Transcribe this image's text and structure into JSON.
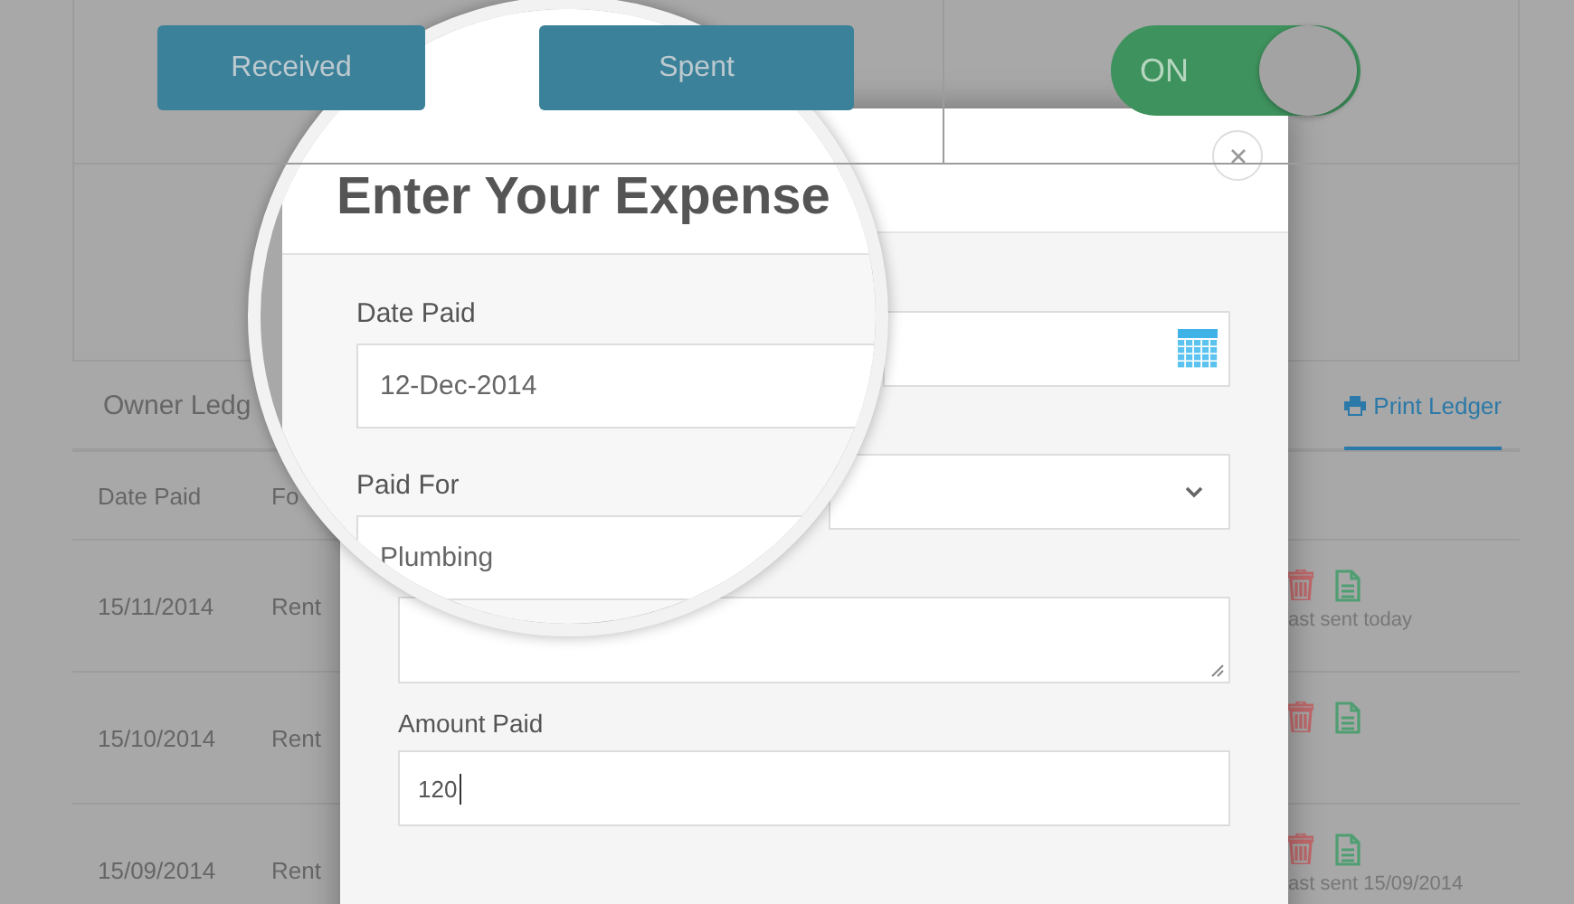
{
  "top_buttons": [
    {
      "label": "Received"
    },
    {
      "label": "Spent"
    }
  ],
  "toggle": {
    "label": "ON",
    "on": true
  },
  "ledger": {
    "tab_label": "Owner Ledg",
    "print_link": "Print Ledger",
    "columns": [
      "Date Paid",
      "Fo"
    ],
    "rows": [
      {
        "date": "15/11/2014",
        "paid_for": "Rent",
        "status": "ast sent today"
      },
      {
        "date": "15/10/2014",
        "paid_for": "Rent"
      },
      {
        "date": "15/09/2014",
        "paid_for": "Rent",
        "status": "ast sent 15/09/2014"
      }
    ]
  },
  "modal": {
    "title": "Enter Your Expense",
    "magnified": true,
    "fields": [
      {
        "kind": "date",
        "label": "Date Paid",
        "value": "12-Dec-2014",
        "magnified": true
      },
      {
        "kind": "select",
        "label": "Paid For",
        "value": "Plumbing",
        "magnified": true
      },
      {
        "kind": "textarea",
        "magnified": false
      },
      {
        "kind": "text",
        "label": "Amount Paid",
        "value": "120",
        "magnified": false
      }
    ]
  }
}
